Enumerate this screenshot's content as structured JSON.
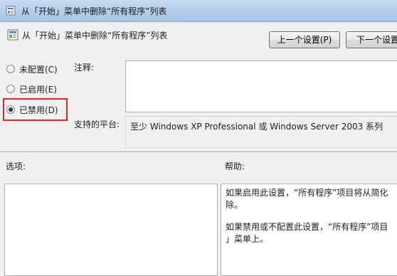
{
  "window": {
    "title": "从「开始」菜单中删除“所有程序”列表",
    "icon": "policy-settings-icon"
  },
  "header": {
    "title": "从「开始」菜单中删除“所有程序”列表",
    "icon": "policy-settings-icon"
  },
  "nav": {
    "prev_label": "上一个设置(P)",
    "next_label": "下一个设置"
  },
  "state_options": [
    {
      "label": "未配置(C)",
      "checked": false
    },
    {
      "label": "已启用(E)",
      "checked": false
    },
    {
      "label": "已禁用(D)",
      "checked": true
    }
  ],
  "comment": {
    "label": "注释:",
    "value": ""
  },
  "platform": {
    "label": "支持的平台:",
    "value": "至少 Windows XP Professional 或 Windows Server 2003 系列"
  },
  "options": {
    "label": "选项:"
  },
  "help": {
    "label": "帮助:",
    "paragraphs": [
      "如果启用此设置，“所有程序”项目将从简化\n除。",
      "如果禁用或不配置此设置，“所有程序”项目\n」菜单上。"
    ]
  },
  "colors": {
    "highlight_border": "#e0282a",
    "titlebar": "#b8cfeb"
  }
}
